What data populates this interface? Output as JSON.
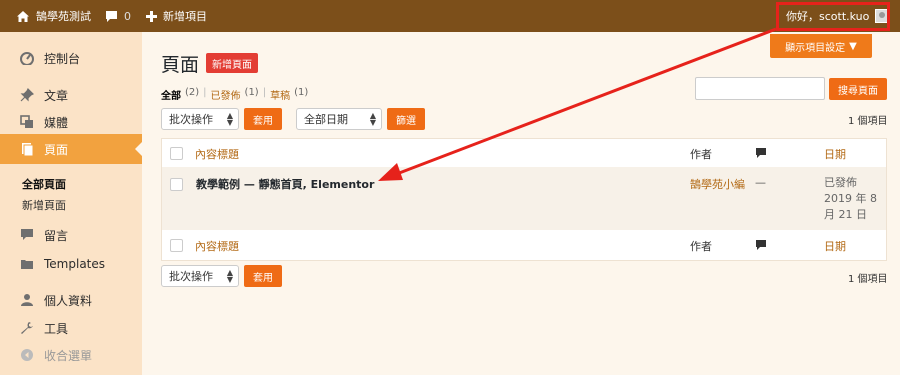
{
  "adminbar": {
    "site_name": "鵠學苑測試",
    "comments_count": "0",
    "new_label": "新增項目",
    "greeting": "你好，scott.kuo"
  },
  "sidebar": {
    "items": [
      {
        "label": "控制台",
        "icon": "dashboard-icon"
      },
      {
        "label": "文章",
        "icon": "pin-icon"
      },
      {
        "label": "媒體",
        "icon": "media-icon"
      },
      {
        "label": "頁面",
        "icon": "page-icon"
      },
      {
        "label": "留言",
        "icon": "comment-icon"
      },
      {
        "label": "Templates",
        "icon": "folder-icon"
      },
      {
        "label": "個人資料",
        "icon": "user-icon"
      },
      {
        "label": "工具",
        "icon": "wrench-icon"
      },
      {
        "label": "收合選單",
        "icon": "collapse-icon"
      }
    ],
    "submenu": [
      "全部頁面",
      "新增頁面"
    ]
  },
  "main": {
    "screen_options": "顯示項目設定",
    "title": "頁面",
    "add_new": "新增頁面",
    "filters": [
      {
        "label": "全部",
        "count": "(2)"
      },
      {
        "label": "已發佈",
        "count": "(1)"
      },
      {
        "label": "草稿",
        "count": "(1)"
      }
    ],
    "search_button": "搜尋頁面",
    "bulk_action": "批次操作",
    "apply": "套用",
    "date_filter": "全部日期",
    "filter_button": "篩選",
    "item_count": "1 個項目",
    "table": {
      "col_title": "內容標題",
      "col_author": "作者",
      "col_date": "日期",
      "rows": [
        {
          "title": "教學範例 — 靜態首頁, Elementor",
          "author": "鵠學苑小編",
          "comments": "—",
          "date_status": "已發佈",
          "date_line1": "2019 年 8",
          "date_line2": "月 21 日"
        }
      ]
    }
  },
  "colors": {
    "adminbar": "#7c4f1a",
    "sidebar": "#fbe3c7",
    "accent": "#ef6b15",
    "annotation": "#e6221b"
  }
}
